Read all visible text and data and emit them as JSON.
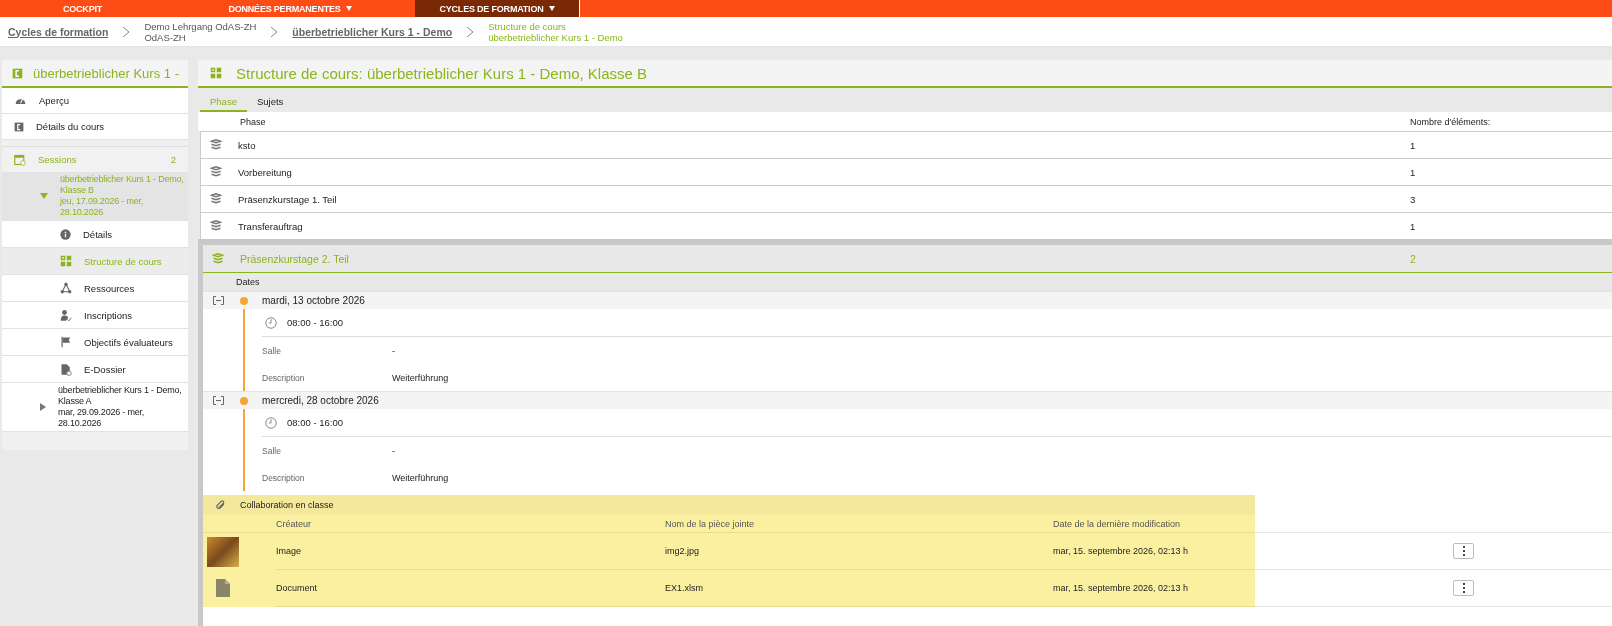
{
  "top_nav": [
    {
      "label": "COCKPIT",
      "dropdown": false,
      "selected": false
    },
    {
      "label": "DONNÉES PERMANENTES",
      "dropdown": true,
      "selected": false
    },
    {
      "label": "CYCLES DE FORMATION",
      "dropdown": true,
      "selected": true
    }
  ],
  "breadcrumb": [
    {
      "kind": "link",
      "lines": [
        "Cycles de formation"
      ]
    },
    {
      "kind": "text",
      "lines": [
        "Demo Lehrgang OdAS-ZH",
        "OdAS-ZH"
      ]
    },
    {
      "kind": "link",
      "lines": [
        "überbetrieblicher Kurs 1 - Demo"
      ]
    },
    {
      "kind": "current",
      "lines": [
        "Structure de cours",
        "überbetrieblicher Kurs 1 - Demo"
      ]
    }
  ],
  "sidebar": {
    "title": "überbetrieblicher Kurs 1 -",
    "items": [
      "Aperçu",
      "Détails du cours"
    ],
    "sessions": {
      "label": "Sessions",
      "count": "2",
      "list": [
        {
          "title": "überbetrieblicher Kurs 1 - Demo, Klasse B",
          "dates": "jeu, 17.09.2026 - mer, 28.10.2026",
          "expanded": true,
          "children": [
            {
              "label": "Détails",
              "selected": false
            },
            {
              "label": "Structure de cours",
              "selected": true
            },
            {
              "label": "Ressources",
              "selected": false
            },
            {
              "label": "Inscriptions",
              "selected": false
            },
            {
              "label": "Objectifs évaluateurs",
              "selected": false
            },
            {
              "label": "E-Dossier",
              "selected": false
            }
          ]
        },
        {
          "title": "überbetrieblicher Kurs 1 - Demo, Klasse A",
          "dates": "mar, 29.09.2026 - mer, 28.10.2026",
          "expanded": false
        }
      ]
    }
  },
  "main": {
    "title": "Structure de cours: überbetrieblicher Kurs 1 - Demo, Klasse B",
    "tabs": [
      {
        "label": "Phase",
        "selected": true
      },
      {
        "label": "Sujets",
        "selected": false
      }
    ],
    "columns": [
      "Phase",
      "Nombre d'éléments:"
    ],
    "rows": [
      {
        "name": "ksto",
        "count": "1"
      },
      {
        "name": "Vorbereitung",
        "count": "1"
      },
      {
        "name": "Präsenzkurstage 1. Teil",
        "count": "3"
      },
      {
        "name": "Transferauftrag",
        "count": "1"
      }
    ],
    "expanded_phase": {
      "name": "Präsenzkurstage 2. Teil",
      "count": "2",
      "dates_header": "Dates",
      "dates": [
        {
          "date": "mardi, 13 octobre 2026",
          "expanded": true,
          "time": "08:00 - 16:00",
          "fields": [
            {
              "label": "Salle",
              "value": "-"
            },
            {
              "label": "Description",
              "value": "Weiterführung"
            }
          ]
        },
        {
          "date": "mercredi, 28 octobre 2026",
          "expanded": true,
          "time": "08:00 - 16:00",
          "fields": [
            {
              "label": "Salle",
              "value": "-"
            },
            {
              "label": "Description",
              "value": "Weiterführung"
            }
          ]
        }
      ],
      "attachments": {
        "title": "Collaboration en classe",
        "columns": [
          "Créateur",
          "Nom de la pièce jointe",
          "Date de la dernière modification"
        ],
        "rows": [
          {
            "kind": "image",
            "creator": "Image",
            "name": "img2.jpg",
            "modified": "mar, 15. septembre 2026, 02:13 h"
          },
          {
            "kind": "document",
            "creator": "Document",
            "name": "EX1.xlsm",
            "modified": "mar, 15. septembre 2026, 02:13 h"
          }
        ]
      }
    }
  }
}
